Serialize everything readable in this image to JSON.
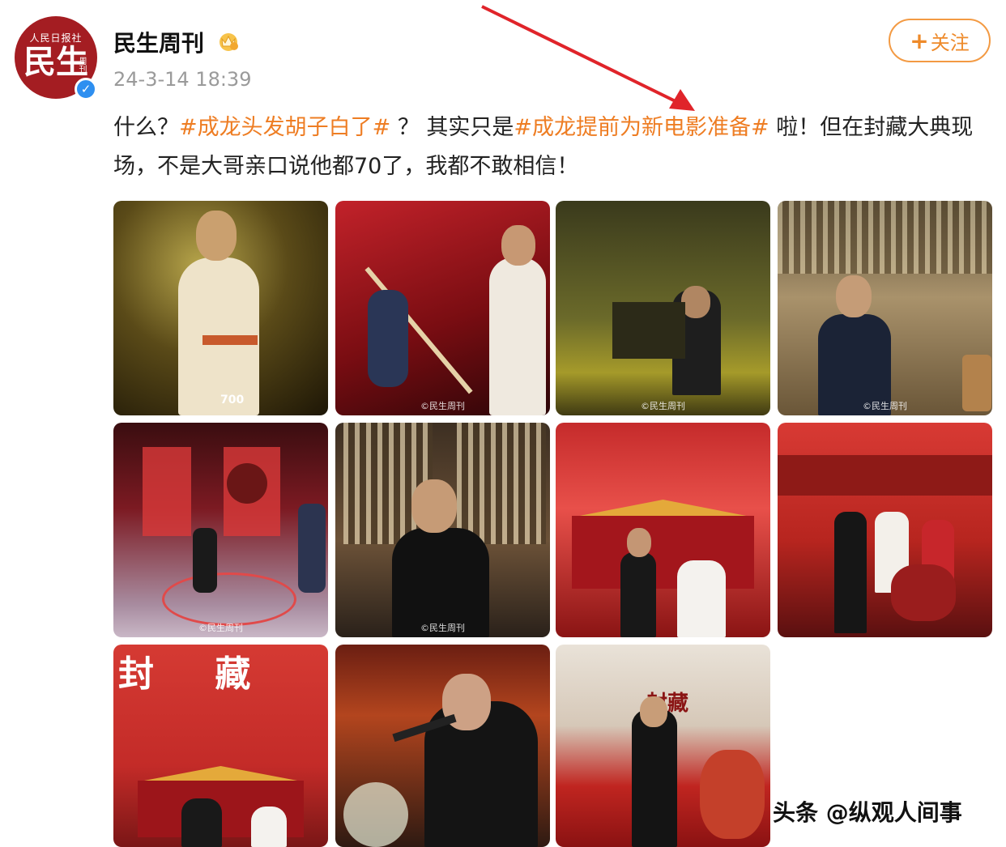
{
  "post": {
    "author": "民生周刊",
    "timestamp": "24-3-14 18:39",
    "follow_label": "关注",
    "avatar": {
      "top_text": "人民日报社",
      "main_text": "民生",
      "side_text": "周刊"
    },
    "text_parts": {
      "p1": "什么？",
      "tag1": "#成龙头发胡子白了#",
      "p2": " ？ 其实只是",
      "tag2": "#成龙提前为新电影准备#",
      "p3": " 啦！但在封藏大典现场，不是大哥亲口说他都70了，我都不敢相信！"
    },
    "watermarks": [
      "©民生周刊",
      "©民生周刊",
      "©民生周刊",
      "©民生周刊",
      "©民生周刊",
      "©民生周刊"
    ],
    "tile_texts": {
      "t0_logo": "700",
      "t9_big": "封 藏",
      "t11_big": "封藏"
    }
  },
  "footer": {
    "credit": "头条 @纵观人间事"
  },
  "colors": {
    "tag": "#ee7d23",
    "follow_border": "#f39a43",
    "verified": "#2e8ff0",
    "avatar": "#a41d22"
  }
}
